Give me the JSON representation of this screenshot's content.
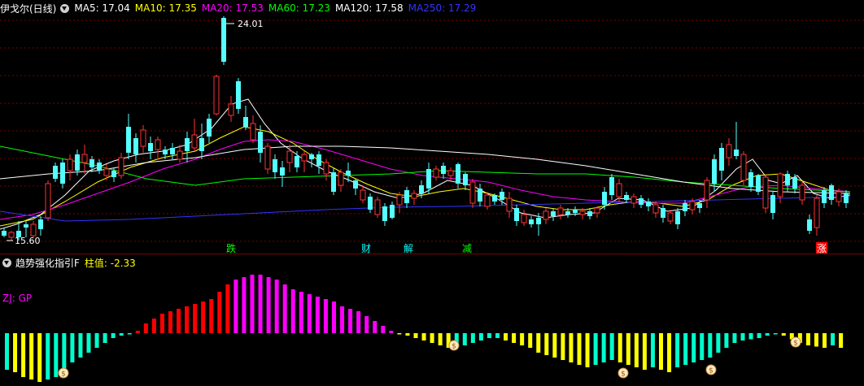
{
  "stock": {
    "name": "伊戈尔(日线)"
  },
  "ma_legend": [
    {
      "label": "MA5: 17.04",
      "color": "#ffffff"
    },
    {
      "label": "MA10: 17.35",
      "color": "#ffff00"
    },
    {
      "label": "MA20: 17.53",
      "color": "#ff00ff"
    },
    {
      "label": "MA60: 17.23",
      "color": "#00ff00"
    },
    {
      "label": "MA120: 17.58",
      "color": "#ffffff"
    },
    {
      "label": "MA250: 17.29",
      "color": "#3333ff"
    }
  ],
  "annotations": {
    "high": "24.01",
    "low": "15.60"
  },
  "signal_labels": [
    {
      "text": "跌",
      "color": "#00ff00",
      "bg": ""
    },
    {
      "text": "财",
      "color": "#00ffff",
      "bg": ""
    },
    {
      "text": "解",
      "color": "#00ffff",
      "bg": ""
    },
    {
      "text": "减",
      "color": "#00ff00",
      "bg": ""
    },
    {
      "text": "涨",
      "color": "#ffffff",
      "bg": "#ff0000"
    }
  ],
  "indicator": {
    "name": "趋势强化指引F",
    "value_label": "柱值: -2.33",
    "zj_label": "ZJ: GP",
    "money_bag_icon": "money-bag-icon"
  },
  "colors": {
    "up": "#ff3232",
    "down": "#54ffff",
    "bar_red": "#ff0000",
    "bar_magenta": "#ff00ff",
    "bar_yellow": "#ffff00",
    "bar_cyan": "#00ffcc",
    "grid": "#7a0000"
  },
  "chart_data": {
    "type": "candlestick",
    "price_high": 24.01,
    "price_low": 15.6,
    "indicator_value": -2.33
  }
}
